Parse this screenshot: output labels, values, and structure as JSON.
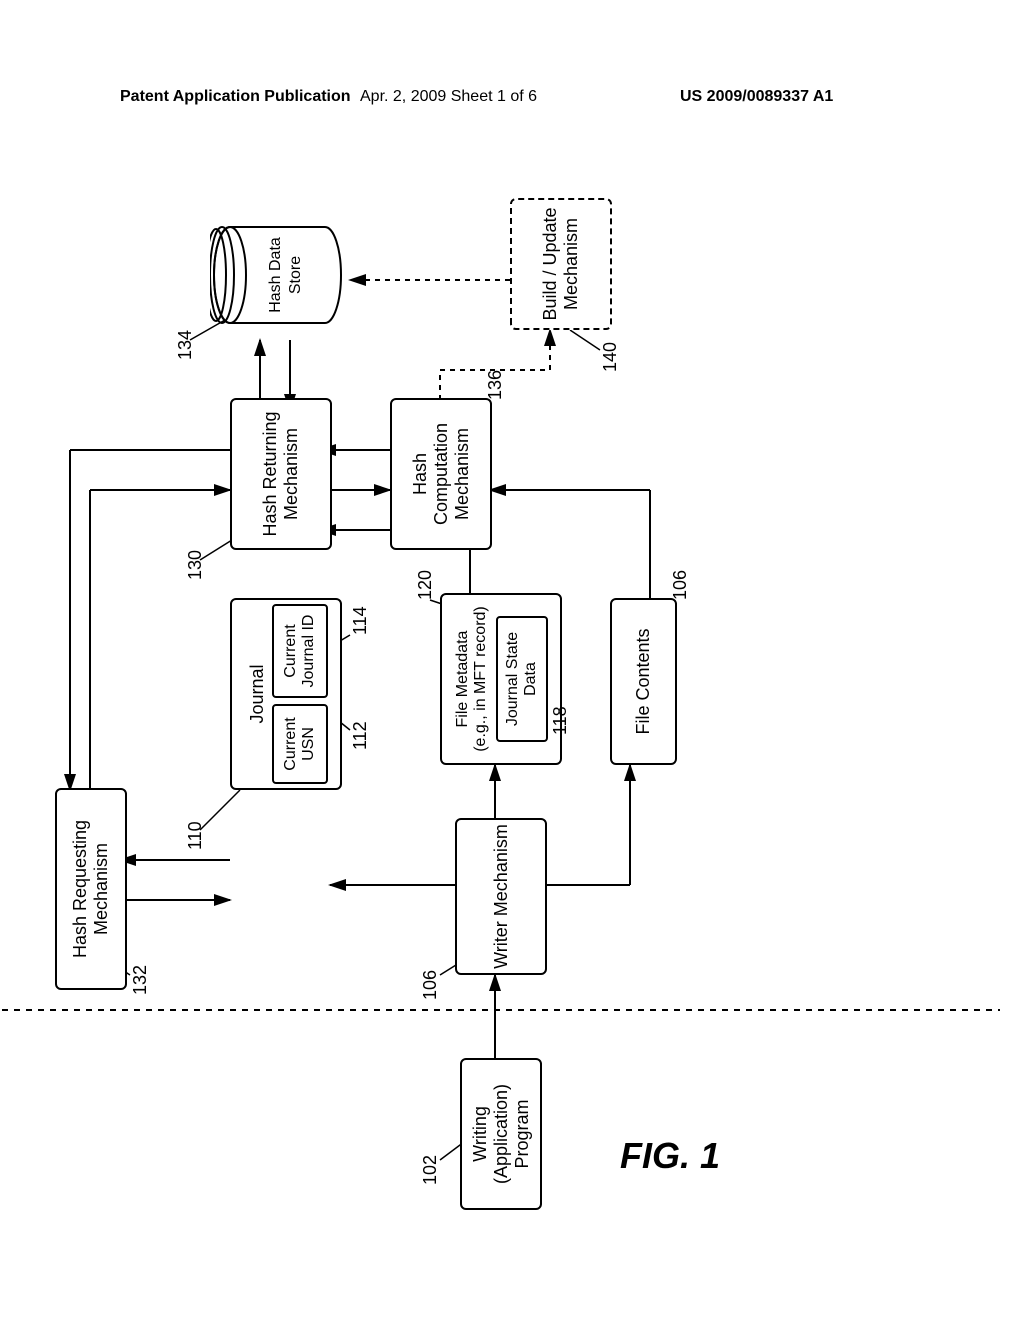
{
  "header": {
    "left": "Patent Application Publication",
    "center": "Apr. 2, 2009  Sheet 1 of 6",
    "right": "US 2009/0089337 A1"
  },
  "figure_label": "FIG. 1",
  "boxes": {
    "writing_app": "Writing (Application)\nProgram",
    "hash_requesting": "Hash Requesting\nMechanism",
    "writer_mech": "Writer Mechanism",
    "journal": "Journal",
    "current_usn": "Current\nUSN",
    "current_jid": "Current\nJournal ID",
    "file_metadata": "File Metadata\n(e.g., in MFT record)",
    "journal_state": "Journal State\nData",
    "file_contents": "File Contents",
    "hash_returning": "Hash Returning\nMechanism",
    "hash_computation": "Hash Computation\nMechanism",
    "hash_data_store": "Hash Data\nStore",
    "build_update": "Build / Update\nMechanism"
  },
  "refs": {
    "r102": "102",
    "r106a": "106",
    "r106b": "106",
    "r110": "110",
    "r112": "112",
    "r114": "114",
    "r118": "118",
    "r120": "120",
    "r130": "130",
    "r132": "132",
    "r134": "134",
    "r136": "136",
    "r140": "140"
  }
}
